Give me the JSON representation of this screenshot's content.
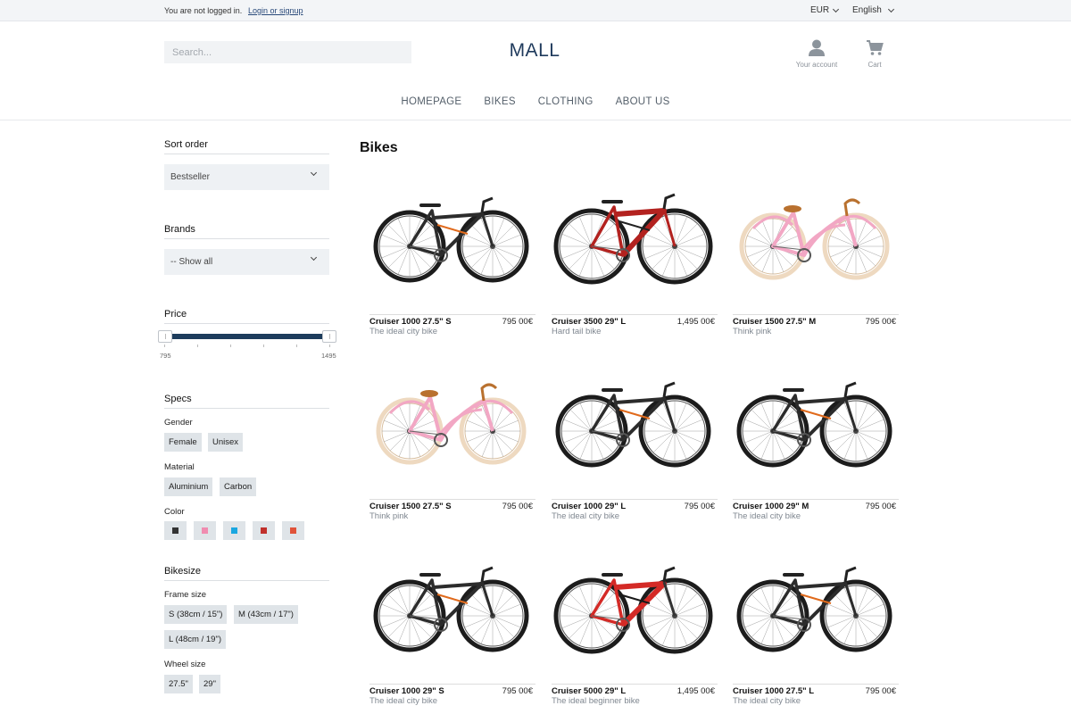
{
  "topbar": {
    "status": "You are not logged in.",
    "login_link": "Login or signup",
    "currency": "EUR",
    "language": "English"
  },
  "header": {
    "search_placeholder": "Search...",
    "logo": "MALL",
    "account_label": "Your account",
    "cart_label": "Cart"
  },
  "nav": [
    "HOMEPAGE",
    "BIKES",
    "CLOTHING",
    "ABOUT US"
  ],
  "sidebar": {
    "sort_title": "Sort order",
    "sort_value": "Bestseller",
    "brands_title": "Brands",
    "brands_value": "-- Show all",
    "price_title": "Price",
    "price_min": "795",
    "price_max": "1495",
    "specs_title": "Specs",
    "gender_label": "Gender",
    "gender_options": [
      "Female",
      "Unisex"
    ],
    "material_label": "Material",
    "material_options": [
      "Aluminium",
      "Carbon"
    ],
    "color_label": "Color",
    "colors": [
      "#333333",
      "#f08cb0",
      "#1aa7e0",
      "#c0302b",
      "#e0533a"
    ],
    "bikesize_title": "Bikesize",
    "frame_label": "Frame size",
    "frame_options": [
      "S (38cm / 15\")",
      "M (43cm / 17\")",
      "L (48cm / 19\")"
    ],
    "wheel_label": "Wheel size",
    "wheel_options": [
      "27.5\"",
      "29\""
    ]
  },
  "main": {
    "title": "Bikes",
    "products": [
      {
        "name": "Cruiser 1000 27.5\" S",
        "price": "795 00€",
        "desc": "The ideal city bike",
        "bike": "hybrid",
        "color": "#2c2c2c",
        "accent": "#e06a1c"
      },
      {
        "name": "Cruiser 3500 29\" L",
        "price": "1,495 00€",
        "desc": "Hard tail bike",
        "bike": "mtb",
        "color": "#b3221f",
        "accent": "#222222"
      },
      {
        "name": "Cruiser 1500 27.5\" M",
        "price": "795 00€",
        "desc": "Think pink",
        "bike": "city",
        "color": "#f2a7c4",
        "accent": "#b9712f"
      },
      {
        "name": "Cruiser 1500 27.5\" S",
        "price": "795 00€",
        "desc": "Think pink",
        "bike": "city",
        "color": "#f2a7c4",
        "accent": "#b9712f"
      },
      {
        "name": "Cruiser 1000 29\" L",
        "price": "795 00€",
        "desc": "The ideal city bike",
        "bike": "hybrid",
        "color": "#2c2c2c",
        "accent": "#e06a1c"
      },
      {
        "name": "Cruiser 1000 29\" M",
        "price": "795 00€",
        "desc": "The ideal city bike",
        "bike": "hybrid",
        "color": "#2c2c2c",
        "accent": "#e06a1c"
      },
      {
        "name": "Cruiser 1000 29\" S",
        "price": "795 00€",
        "desc": "The ideal city bike",
        "bike": "hybrid",
        "color": "#2c2c2c",
        "accent": "#e06a1c"
      },
      {
        "name": "Cruiser 5000 29\" L",
        "price": "1,495 00€",
        "desc": "The ideal beginner bike",
        "bike": "fullsus",
        "color": "#d42a26",
        "accent": "#1a1a1a"
      },
      {
        "name": "Cruiser 1000 27.5\" L",
        "price": "795 00€",
        "desc": "The ideal city bike",
        "bike": "hybrid",
        "color": "#2c2c2c",
        "accent": "#e06a1c"
      }
    ]
  }
}
